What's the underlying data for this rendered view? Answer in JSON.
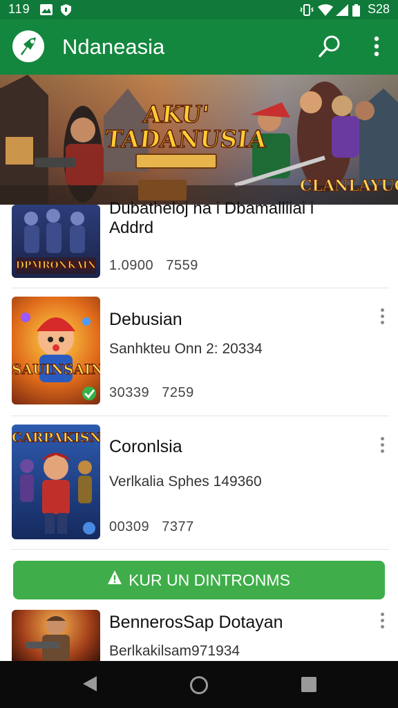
{
  "status_bar": {
    "time": "119",
    "right_text": "S28",
    "left_icons": [
      "image-icon",
      "shield-icon"
    ],
    "right_icons": [
      "vibrate-icon",
      "wifi-icon",
      "signal-icon",
      "battery-icon"
    ]
  },
  "app_bar": {
    "title": "Ndaneasia",
    "logo_icon": "app-logo-icon",
    "actions": [
      "search-icon",
      "overflow-menu-icon"
    ]
  },
  "banner": {
    "title": "AKU' TADANUSIA",
    "subtitle": "",
    "corner_text": "CLANLAYUON"
  },
  "items": [
    {
      "title": "Dubatheloj na i Dbamalliiai i",
      "subtitle": "Addrd",
      "stat_a": "1.0900",
      "stat_b": "7559",
      "thumb_text": "DPMRONKAIN"
    },
    {
      "title": "Debusian",
      "subtitle": "Sanhkteu Onn 2: 20334",
      "stat_a": "30339",
      "stat_b": "7259",
      "thumb_text": "SAUINSAIN"
    },
    {
      "title": "Coronlsia",
      "subtitle": "Verlkalia Sphes 149360",
      "stat_a": "00309",
      "stat_b": "7377",
      "thumb_text": "CARPAKISN"
    },
    {
      "title": "BennerosSap Dotayan",
      "subtitle": "Berlkakilsam971934",
      "thumb_text": ""
    }
  ],
  "cta": {
    "label": "KUR UN DINTRONMS",
    "icon": "alert-icon"
  },
  "colors": {
    "primary": "#14873f",
    "primary_dark": "#0f7a3a",
    "cta": "#3fae4a"
  },
  "nav_bar": {
    "buttons": [
      "back-icon",
      "home-icon",
      "recents-icon"
    ]
  }
}
